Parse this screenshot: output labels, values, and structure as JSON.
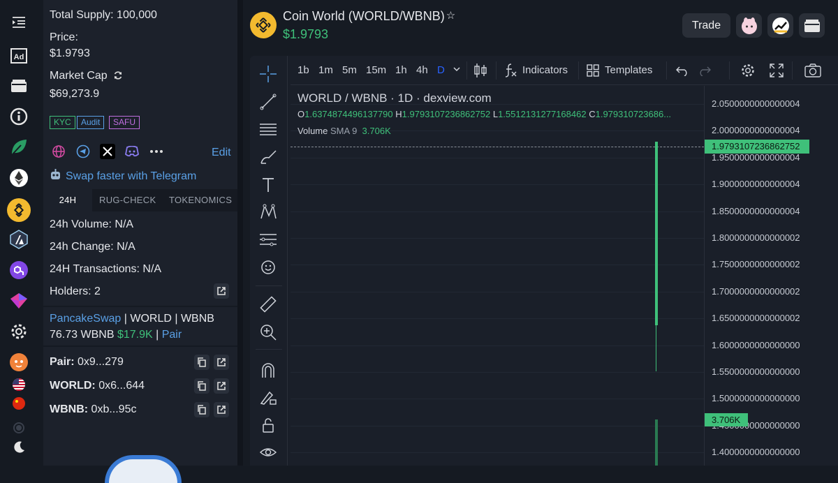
{
  "sidebar_icons": [
    "menu-indent-icon",
    "ad-icon",
    "wallet-icon",
    "info-icon",
    "leaf-icon",
    "ethereum-icon",
    "bnb-chain-icon",
    "arbitrum-icon",
    "polygon-icon",
    "chain-icon",
    "settings-gear-icon",
    "shiba-icon",
    "us-flag-icon",
    "china-flag-icon",
    "dot-icon",
    "moon-icon"
  ],
  "token": {
    "total_supply": "Total Supply: 100,000",
    "price_label": "Price:",
    "price": "$1.9793",
    "market_cap_label": "Market Cap",
    "market_cap": "$69,273.9",
    "badges": [
      "KYC",
      "Audit",
      "SAFU"
    ],
    "edit": "Edit",
    "telegram_cta": "Swap faster with Telegram"
  },
  "tabs": [
    "24H",
    "RUG-CHECK",
    "TOKENOMICS"
  ],
  "stats": {
    "volume": "24h Volume: N/A",
    "change": "24h Change: N/A",
    "tx": "24H Transactions: N/A",
    "holders": "Holders: 2"
  },
  "pool": {
    "dex": "PancakeSwap",
    "pair": " | WORLD | WBNB",
    "liquidity": "76.73 WBNB",
    "liquidity_usd": "$17.9K",
    "sep": " | ",
    "pair_link": "Pair"
  },
  "addresses": [
    {
      "label": "Pair:",
      "value": " 0x9...279"
    },
    {
      "label": "WORLD:",
      "value": " 0x6...644"
    },
    {
      "label": "WBNB:",
      "value": " 0xb...95c"
    }
  ],
  "header": {
    "title": "Coin World (WORLD/WBNB)",
    "star": "☆",
    "price": "$1.9793",
    "trade": "Trade"
  },
  "toolbar": {
    "intervals": [
      "1b",
      "1m",
      "5m",
      "15m",
      "1h",
      "4h",
      "D"
    ],
    "indicators": "Indicators",
    "templates": "Templates"
  },
  "legend": {
    "symbol": "WORLD / WBNB · 1D · dexview.com",
    "o_lbl": "O",
    "o": "1.6374874496137790",
    "h_lbl": "H",
    "h": "1.9793107236862752",
    "l_lbl": "L",
    "l": "1.5512131277168462",
    "c_lbl": "C",
    "c": "1.979310723686...",
    "vol_lbl": "Volume",
    "sma": "SMA 9",
    "vol": "3.706K"
  },
  "yaxis": [
    "2.0500000000000004",
    "2.0000000000000004",
    "1.9500000000000004",
    "1.9000000000000004",
    "1.8500000000000004",
    "1.8000000000000002",
    "1.7500000000000002",
    "1.7000000000000002",
    "1.6500000000000002",
    "1.6000000000000000",
    "1.5500000000000000",
    "1.5000000000000000",
    "1.4500000000000000",
    "1.4000000000000000"
  ],
  "last_price": "1.9793107236862752",
  "vol_marker": "3.706K",
  "colors": {
    "up": "#3fc07a",
    "accent": "#5aa0e6",
    "bg": "#161b23"
  }
}
